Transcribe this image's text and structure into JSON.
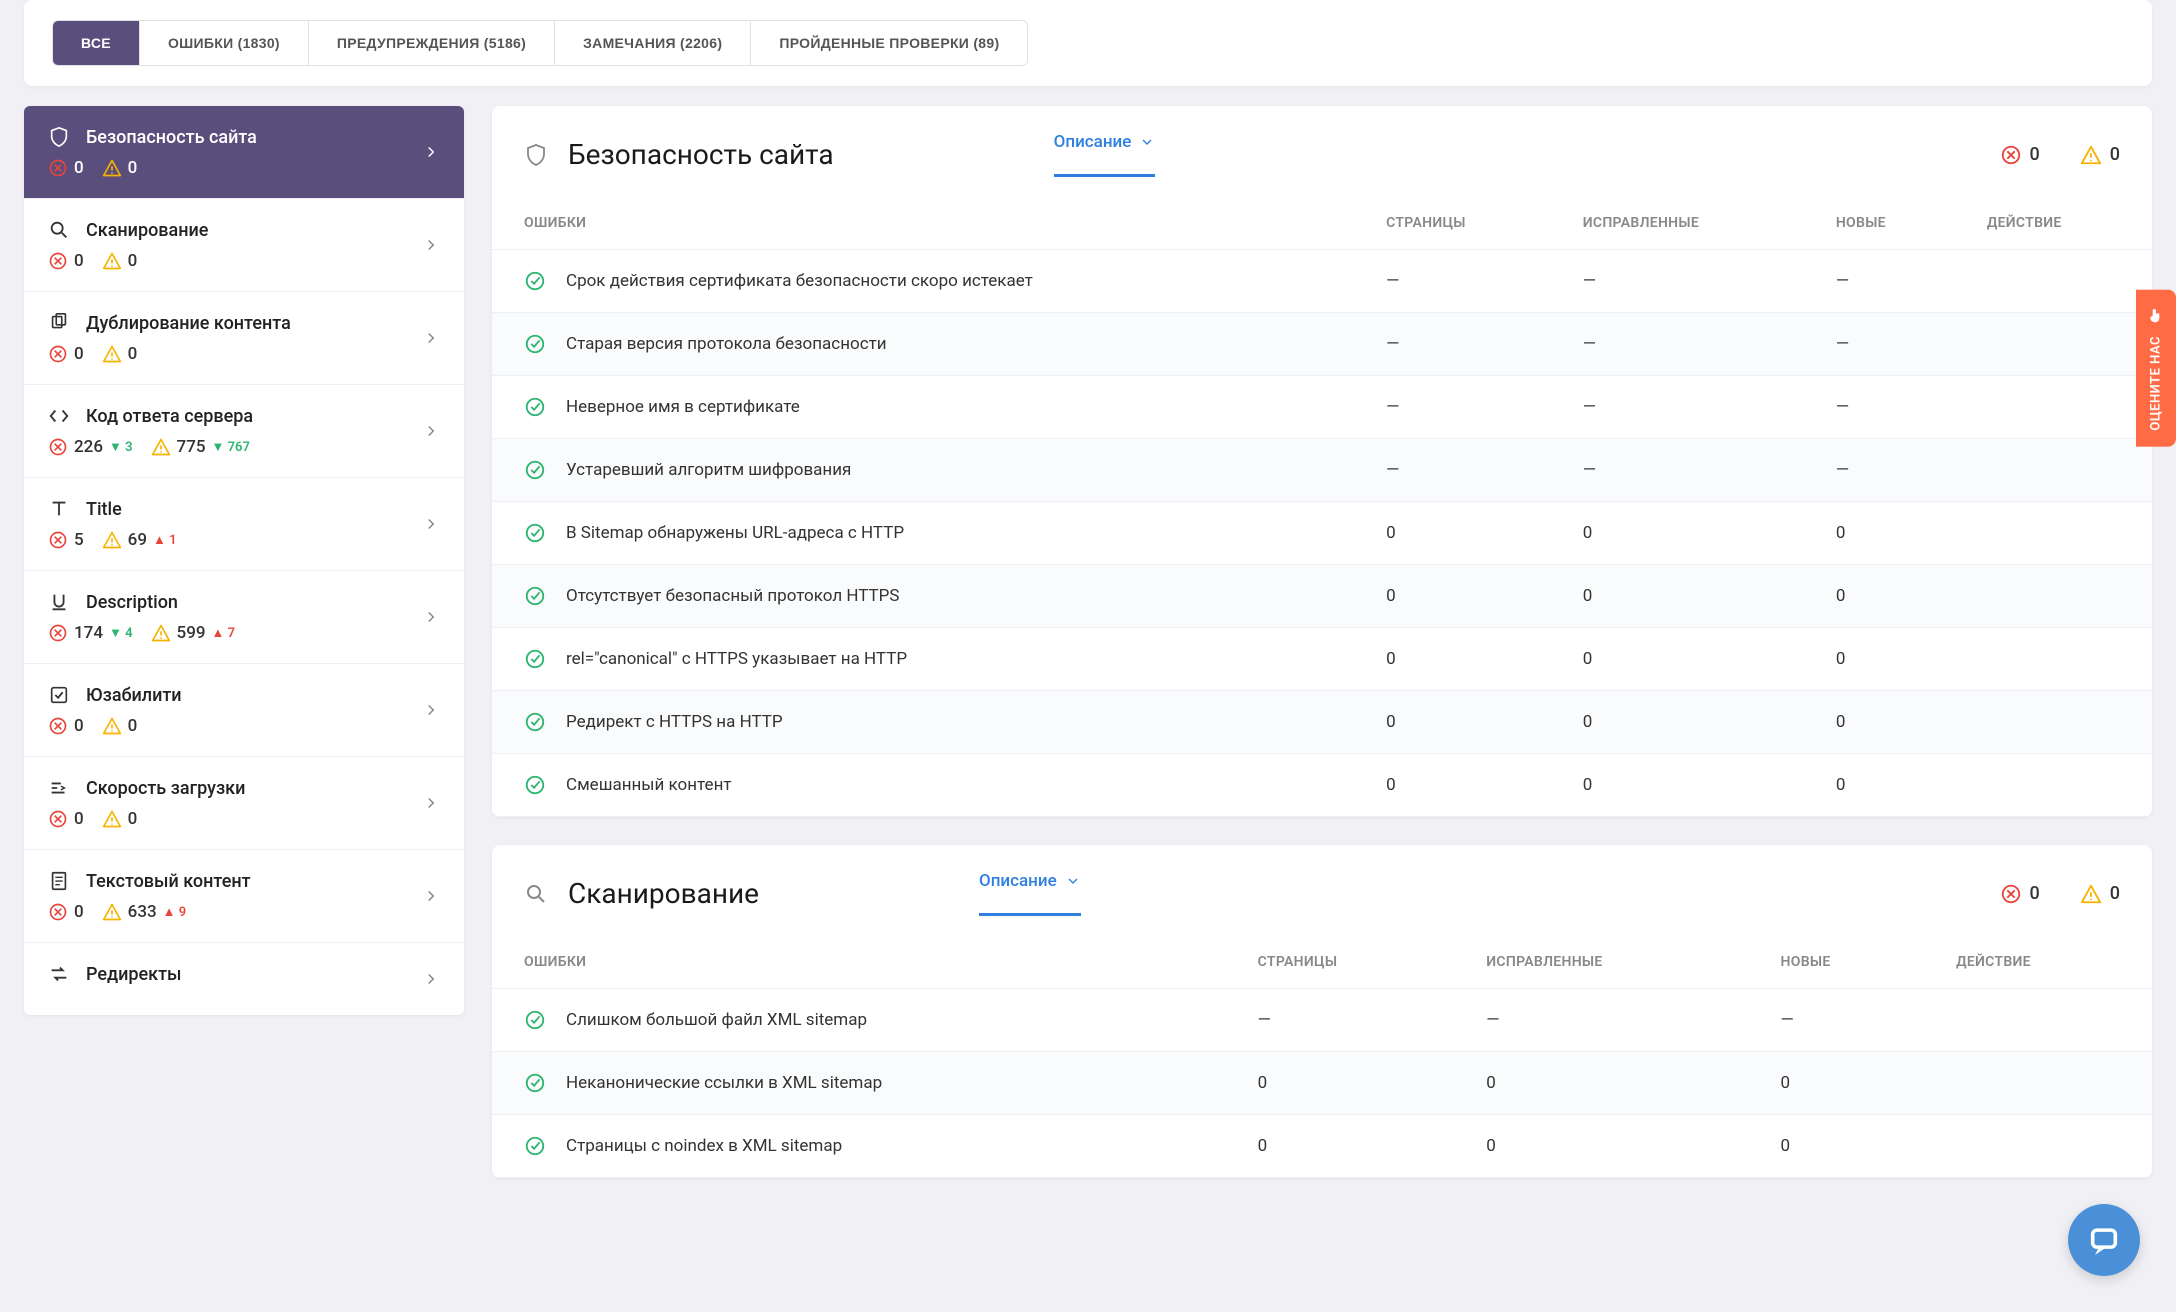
{
  "tabs": [
    {
      "label": "ВСЕ",
      "active": true
    },
    {
      "label": "ОШИБКИ (1830)"
    },
    {
      "label": "ПРЕДУПРЕЖДЕНИЯ (5186)"
    },
    {
      "label": "ЗАМЕЧАНИЯ (2206)"
    },
    {
      "label": "ПРОЙДЕННЫЕ ПРОВЕРКИ (89)"
    }
  ],
  "sidebar": [
    {
      "icon": "shield",
      "title": "Безопасность сайта",
      "errors": "0",
      "err_delta": "",
      "warns": "0",
      "warn_delta": "",
      "active": true
    },
    {
      "icon": "search",
      "title": "Сканирование",
      "errors": "0",
      "err_delta": "",
      "warns": "0",
      "warn_delta": ""
    },
    {
      "icon": "copy",
      "title": "Дублирование контента",
      "errors": "0",
      "err_delta": "",
      "warns": "0",
      "warn_delta": ""
    },
    {
      "icon": "code",
      "title": "Код ответа сервера",
      "errors": "226",
      "err_delta": "▼ 3",
      "err_delta_dir": "down",
      "warns": "775",
      "warn_delta": "▼ 767",
      "warn_delta_dir": "down"
    },
    {
      "icon": "text",
      "title": "Title",
      "errors": "5",
      "err_delta": "",
      "warns": "69",
      "warn_delta": "▲ 1",
      "warn_delta_dir": "up"
    },
    {
      "icon": "underline",
      "title": "Description",
      "errors": "174",
      "err_delta": "▼ 4",
      "err_delta_dir": "down",
      "warns": "599",
      "warn_delta": "▲ 7",
      "warn_delta_dir": "up"
    },
    {
      "icon": "check",
      "title": "Юзабилити",
      "errors": "0",
      "err_delta": "",
      "warns": "0",
      "warn_delta": ""
    },
    {
      "icon": "speed",
      "title": "Скорость загрузки",
      "errors": "0",
      "err_delta": "",
      "warns": "0",
      "warn_delta": ""
    },
    {
      "icon": "doc",
      "title": "Текстовый контент",
      "errors": "0",
      "err_delta": "",
      "warns": "633",
      "warn_delta": "▲ 9",
      "warn_delta_dir": "up"
    },
    {
      "icon": "redirect",
      "title": "Редиректы",
      "errors": "",
      "err_delta": "",
      "warns": "",
      "warn_delta": ""
    }
  ],
  "sections": [
    {
      "icon": "shield",
      "title": "Безопасность сайта",
      "tab_label": "Описание",
      "errors": "0",
      "warns": "0",
      "columns": [
        "ОШИБКИ",
        "СТРАНИЦЫ",
        "ИСПРАВЛЕННЫЕ",
        "НОВЫЕ",
        "ДЕЙСТВИЕ"
      ],
      "rows": [
        {
          "name": "Срок действия сертификата безопасности скоро истекает",
          "pages": "—",
          "fixed": "—",
          "new": "—"
        },
        {
          "name": "Старая версия протокола безопасности",
          "pages": "—",
          "fixed": "—",
          "new": "—"
        },
        {
          "name": "Неверное имя в сертификате",
          "pages": "—",
          "fixed": "—",
          "new": "—"
        },
        {
          "name": "Устаревший алгоритм шифрования",
          "pages": "—",
          "fixed": "—",
          "new": "—"
        },
        {
          "name": "В Sitemap обнаружены URL-адреса с HTTP",
          "pages": "0",
          "fixed": "0",
          "new": "0"
        },
        {
          "name": "Отсутствует безопасный протокол HTTPS",
          "pages": "0",
          "fixed": "0",
          "new": "0"
        },
        {
          "name": "rel=\"canonical\" с HTTPS указывает на HTTP",
          "pages": "0",
          "fixed": "0",
          "new": "0"
        },
        {
          "name": "Редирект с HTTPS на HTTP",
          "pages": "0",
          "fixed": "0",
          "new": "0"
        },
        {
          "name": "Смешанный контент",
          "pages": "0",
          "fixed": "0",
          "new": "0"
        }
      ]
    },
    {
      "icon": "search",
      "title": "Сканирование",
      "tab_label": "Описание",
      "errors": "0",
      "warns": "0",
      "columns": [
        "ОШИБКИ",
        "СТРАНИЦЫ",
        "ИСПРАВЛЕННЫЕ",
        "НОВЫЕ",
        "ДЕЙСТВИЕ"
      ],
      "rows": [
        {
          "name": "Слишком большой файл XML sitemap",
          "pages": "—",
          "fixed": "—",
          "new": "—"
        },
        {
          "name": "Неканонические ссылки в XML sitemap",
          "pages": "0",
          "fixed": "0",
          "new": "0"
        },
        {
          "name": "Страницы с noindex в XML sitemap",
          "pages": "0",
          "fixed": "0",
          "new": "0"
        }
      ]
    }
  ],
  "feedback": "ОЦЕНИТЕ НАС"
}
